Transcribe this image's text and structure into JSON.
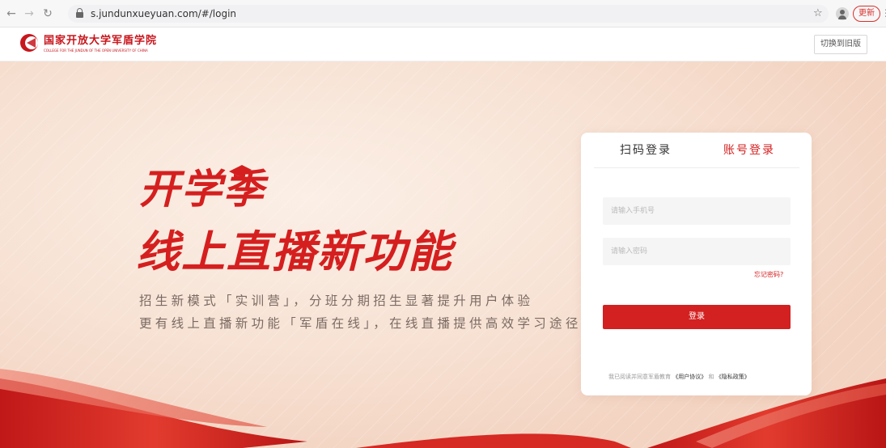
{
  "browser": {
    "url": "s.jundunxueyuan.com/#/login",
    "update_label": "更新"
  },
  "header": {
    "school_name": "国家开放大学军盾学院",
    "school_name_en": "COLLEGE FOR THE JUNDUN OF THE OPEN UNIVERSITY OF CHINA",
    "switch_label": "切换到旧版"
  },
  "hero": {
    "title_line1": "开学季",
    "title_line2": "线上直播新功能",
    "desc_line1": "招生新模式「实训营」，分班分期招生显著提升用户体验",
    "desc_line2": "更有线上直播新功能「军盾在线」，在线直播提供高效学习途径"
  },
  "login": {
    "tab_qr": "扫码登录",
    "tab_account": "账号登录",
    "phone_placeholder": "请输入手机号",
    "password_placeholder": "请输入密码",
    "forgot": "忘记密码?",
    "submit": "登录",
    "agreement_prefix": "我已阅读并同意军盾教育",
    "user_agreement": "《用户协议》",
    "agreement_and": "和",
    "privacy_policy": "《隐私政策》"
  },
  "colors": {
    "brand_red": "#d51f1f",
    "button_red": "#d32020"
  },
  "icons": [
    "back-arrow-icon",
    "forward-arrow-icon",
    "reload-icon",
    "lock-icon",
    "bookmark-star-icon",
    "profile-icon",
    "menu-dots-icon",
    "school-logo-icon",
    "graduation-cap-icon"
  ]
}
